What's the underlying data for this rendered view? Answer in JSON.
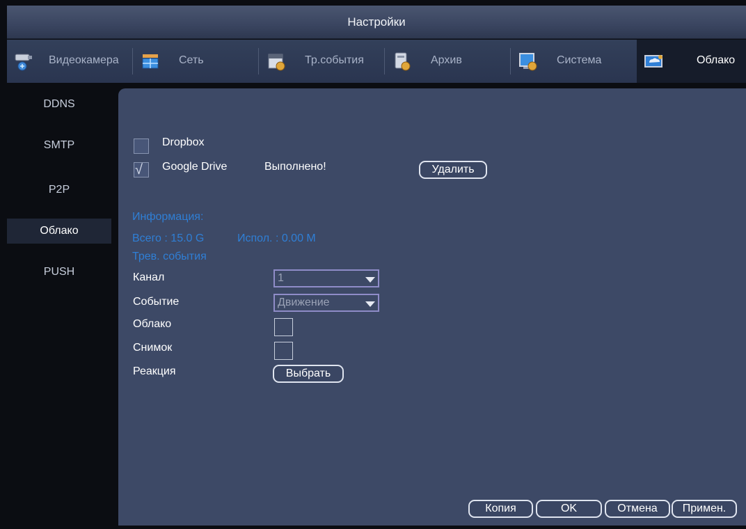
{
  "window": {
    "title": "Настройки"
  },
  "tabs": [
    {
      "label": "Видеокамера",
      "icon": "camera-icon"
    },
    {
      "label": "Сеть",
      "icon": "network-icon"
    },
    {
      "label": "Тр.события",
      "icon": "event-icon"
    },
    {
      "label": "Архив",
      "icon": "storage-icon"
    },
    {
      "label": "Система",
      "icon": "system-icon"
    },
    {
      "label": "Облако",
      "icon": "cloud-icon",
      "active": true
    }
  ],
  "sidebar": {
    "items": [
      {
        "label": "DDNS"
      },
      {
        "label": "SMTP"
      },
      {
        "label": "P2P"
      },
      {
        "label": "Облако",
        "active": true
      },
      {
        "label": "PUSH"
      }
    ]
  },
  "cloud": {
    "dropbox": {
      "label": "Dropbox",
      "checked": false
    },
    "google_drive": {
      "label": "Google Drive",
      "checked": true,
      "status": "Выполнено!"
    },
    "delete_label": "Удалить"
  },
  "info": {
    "heading": "Информация:",
    "total": "Всего : 15.0 G",
    "used": "Испол. : 0.00 M"
  },
  "alarm": {
    "heading": "Трев. события",
    "channel_label": "Канал",
    "channel_value": "1",
    "event_label": "Событие",
    "event_value": "Движение",
    "cloud_label": "Облако",
    "snapshot_label": "Снимок",
    "action_label": "Реакция",
    "select_label": "Выбрать"
  },
  "footer": {
    "copy": "Копия",
    "ok": "OK",
    "cancel": "Отмена",
    "apply": "Примен."
  },
  "colors": {
    "panel": "#3d4966",
    "info_text": "#2f7fd6",
    "select_border": "#8f8cc8"
  }
}
